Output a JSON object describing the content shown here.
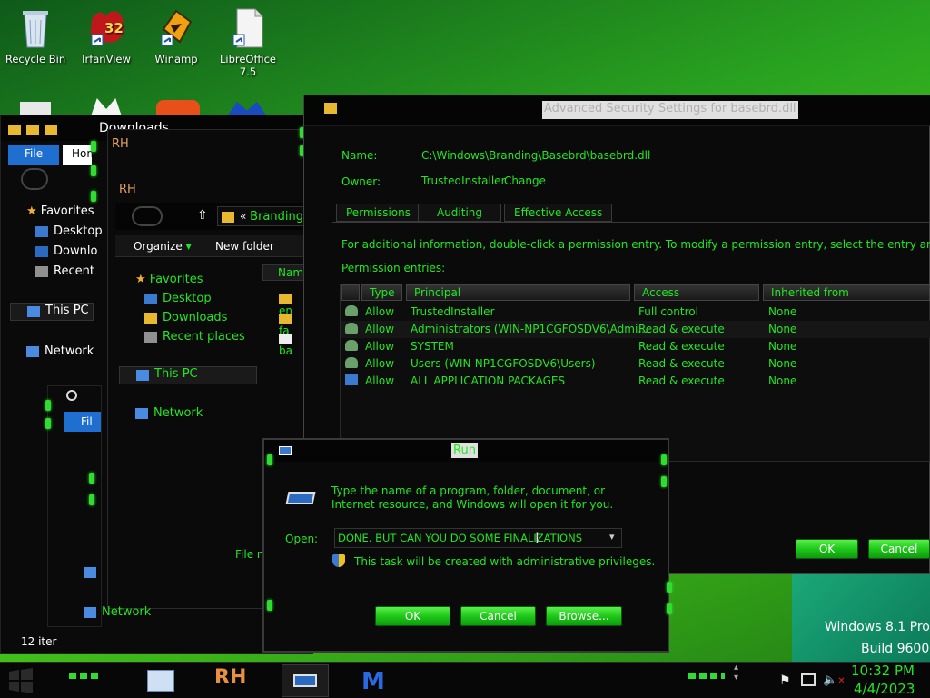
{
  "desktop": {
    "icons": [
      {
        "label": "Recycle Bin",
        "badge": ""
      },
      {
        "label": "IrfanView",
        "badge": "32"
      },
      {
        "label": "Winamp",
        "badge": ""
      },
      {
        "label": "LibreOffice 7.5",
        "badge": ""
      }
    ],
    "watermark": {
      "line1": "Windows 8.1 Pro",
      "line2": "Build 9600"
    }
  },
  "explorer_back": {
    "title": "Downloads",
    "ribbon_tabs": [
      "File",
      "Hom"
    ],
    "nav": [
      "Favorites",
      "Desktop",
      "Downlo",
      "Recent",
      "This PC",
      "Network"
    ],
    "status": "12 iter",
    "small_tab": "Fil"
  },
  "explorer_mid": {
    "logo": "RH",
    "address_prefix": "«",
    "address_folder": "Branding",
    "toolbar": {
      "organize": "Organize",
      "new_folder": "New folder"
    },
    "nav": [
      "Favorites",
      "Desktop",
      "Downloads",
      "Recent places",
      "This PC",
      "Network"
    ],
    "column_name": "Name",
    "files": [
      "en",
      "fa",
      "ba"
    ],
    "file_name_label": "File n",
    "network_label": "Network"
  },
  "security": {
    "title": "Advanced Security Settings for basebrd.dll",
    "name_label": "Name:",
    "name_value": "C:\\Windows\\Branding\\Basebrd\\basebrd.dll",
    "owner_label": "Owner:",
    "owner_value": "TrustedInstaller",
    "change_link": "Change",
    "tabs": [
      "Permissions",
      "Auditing",
      "Effective Access"
    ],
    "info_text": "For additional information, double-click a permission entry. To modify a permission entry, select the entry and click Edit (if",
    "entries_label": "Permission entries:",
    "columns": [
      "Type",
      "Principal",
      "Access",
      "Inherited from"
    ],
    "rows": [
      {
        "type": "Allow",
        "principal": "TrustedInstaller",
        "access": "Full control",
        "inherited": "None"
      },
      {
        "type": "Allow",
        "principal": "Administrators (WIN-NP1CGFOSDV6\\Admi...",
        "access": "Read & execute",
        "inherited": "None"
      },
      {
        "type": "Allow",
        "principal": "SYSTEM",
        "access": "Read & execute",
        "inherited": "None"
      },
      {
        "type": "Allow",
        "principal": "Users (WIN-NP1CGFOSDV6\\Users)",
        "access": "Read & execute",
        "inherited": "None"
      },
      {
        "type": "Allow",
        "principal": "ALL APPLICATION PACKAGES",
        "access": "Read & execute",
        "inherited": "None"
      }
    ],
    "ok": "OK",
    "cancel": "Cancel"
  },
  "run": {
    "title": "Run",
    "description": "Type the name of a program, folder, document, or Internet resource, and Windows will open it for you.",
    "open_label": "Open:",
    "open_value": "DONE. BUT CAN YOU DO SOME FINALIZATIONS",
    "admin_note": "This task will be created with administrative privileges.",
    "ok": "OK",
    "cancel": "Cancel",
    "browse": "Browse..."
  },
  "taskbar": {
    "rh_label": "RH",
    "time": "10:32 PM",
    "date": "4/4/2023"
  },
  "colors": {
    "accent": "#22e622",
    "button": "#1fc81a",
    "window": "#0a0a0a"
  }
}
